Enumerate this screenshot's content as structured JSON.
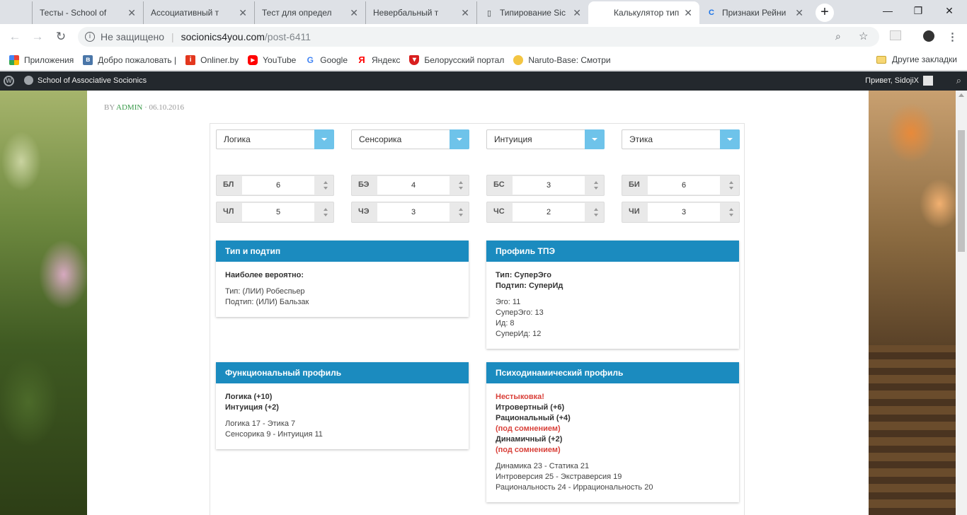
{
  "browser": {
    "tabs": [
      {
        "title": "Тесты - School of",
        "active": false
      },
      {
        "title": "Ассоциативный т",
        "active": false
      },
      {
        "title": "Тест для определ",
        "active": false
      },
      {
        "title": "Невербальный т",
        "active": false
      },
      {
        "title": "Типирование Sic",
        "active": false
      },
      {
        "title": "Калькулятор тип",
        "active": true
      },
      {
        "title": "Признаки Рейни",
        "active": false
      }
    ],
    "security_label": "Не защищено",
    "url_host": "socionics4you.com",
    "url_path": "/post-6411",
    "bookmarks": [
      {
        "label": "Приложения",
        "icon": "apps-grid-icon"
      },
      {
        "label": "Добро пожаловать |",
        "icon": "vk-icon"
      },
      {
        "label": "Onliner.by",
        "icon": "onliner-icon"
      },
      {
        "label": "YouTube",
        "icon": "youtube-icon"
      },
      {
        "label": "Google",
        "icon": "google-icon"
      },
      {
        "label": "Яндекс",
        "icon": "yandex-icon"
      },
      {
        "label": "Белорусский портал",
        "icon": "shield-icon"
      },
      {
        "label": "Naruto-Base: Смотри",
        "icon": "naruto-icon"
      }
    ],
    "other_bookmarks": "Другие закладки"
  },
  "wpbar": {
    "site_name": "School of Associative Socionics",
    "greeting": "Привет, SidojiX"
  },
  "post": {
    "by": "BY",
    "author": "ADMIN",
    "date": " · 06.10.2016"
  },
  "selects": [
    {
      "value": "Логика"
    },
    {
      "value": "Сенсорика"
    },
    {
      "value": "Интуиция"
    },
    {
      "value": "Этика"
    }
  ],
  "inputs": [
    {
      "label": "БЛ",
      "value": "6"
    },
    {
      "label": "БЭ",
      "value": "4"
    },
    {
      "label": "БС",
      "value": "3"
    },
    {
      "label": "БИ",
      "value": "6"
    },
    {
      "label": "ЧЛ",
      "value": "5"
    },
    {
      "label": "ЧЭ",
      "value": "3"
    },
    {
      "label": "ЧС",
      "value": "2"
    },
    {
      "label": "ЧИ",
      "value": "3"
    }
  ],
  "panels": {
    "type": {
      "title": "Тип и подтип",
      "heading": "Наиболее вероятно:",
      "line1": "Тип: (ЛИИ) Робеспьер",
      "line2": "Подтип: (ИЛИ) Бальзак"
    },
    "tpe": {
      "title": "Профиль ТПЭ",
      "b1": "Тип: СуперЭго",
      "b2": "Подтип: СуперИд",
      "l1": "Эго: 11",
      "l2": "СуперЭго: 13",
      "l3": "Ид: 8",
      "l4": "СуперИд: 12"
    },
    "func": {
      "title": "Функциональный профиль",
      "b1": "Логика (+10)",
      "b2": "Интуиция (+2)",
      "l1": "Логика 17 - Этика 7",
      "l2": "Сенсорика 9 - Интуиция 11"
    },
    "psycho": {
      "title": "Психодинамический профиль",
      "r1": "Нестыковка!",
      "b1": "Итровертный (+6)",
      "b2": "Рациональный (+4)",
      "r2": "(под сомнением)",
      "b3": "Динамичный (+2)",
      "r3": "(под сомнением)",
      "l1": "Динамика 23 - Статика 21",
      "l2": "Интроверсия 25 - Экстраверсия 19",
      "l3": "Рациональность 24 - Иррациональность 20"
    }
  },
  "colors": {
    "panel_header": "#1b8bbf",
    "select_arrow": "#6ec3ea",
    "warning_red": "#d9413a",
    "author_green": "#3a9a4a",
    "wp_bar": "#23282d"
  }
}
